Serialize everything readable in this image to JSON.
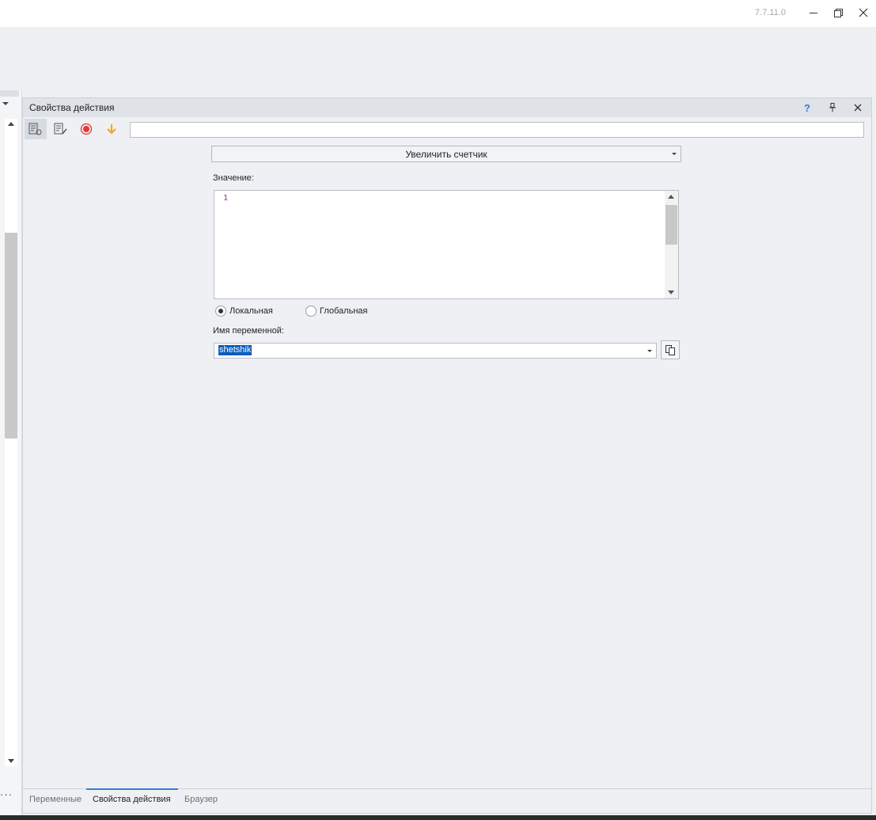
{
  "window": {
    "version": "7.7.11.0",
    "minimize_glyph": "—",
    "restore_glyph": "❐",
    "close_glyph": "✕"
  },
  "left_panel": {
    "more_glyph": "···"
  },
  "panel": {
    "title": "Свойства действия",
    "help_glyph": "?",
    "pin_glyph": "📌",
    "close_glyph": "✕",
    "toolbar": {
      "icons": [
        "action-settings-icon",
        "action-edit-icon",
        "record-icon",
        "down-arrow-icon"
      ],
      "search_value": ""
    },
    "action_select": {
      "selected": "Увеличить счетчик"
    },
    "value_label": "Значение:",
    "value_editor": {
      "line_number": "1",
      "content": ""
    },
    "scope": {
      "options": [
        "Локальная",
        "Глобальная"
      ],
      "selected": "Локальная"
    },
    "variable_label": "Имя переменной:",
    "variable_name": "shetshik"
  },
  "tabs": [
    {
      "label": "Переменные",
      "active": false
    },
    {
      "label": "Свойства действия",
      "active": true
    },
    {
      "label": "Браузер",
      "active": false
    }
  ],
  "colors": {
    "accent": "#3a7bd5",
    "record": "#e53935",
    "arrow": "#f5a623",
    "help": "#3a7bd5",
    "selection": "#0a5dbd"
  }
}
